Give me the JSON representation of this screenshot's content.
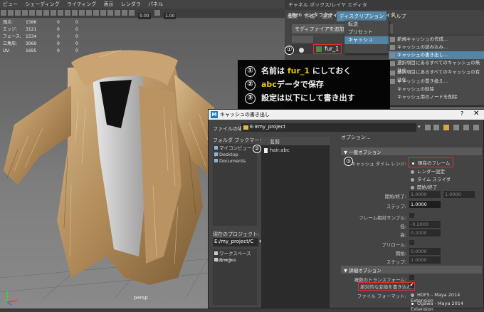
{
  "viewport": {
    "menu": [
      "ビュー",
      "シェーディング",
      "ライティング",
      "表示",
      "レンダラ",
      "パネル"
    ],
    "numbers": [
      "0.00",
      "1.00"
    ],
    "hud": [
      {
        "label": "頂点:",
        "v1": "1586",
        "v2": "0",
        "v3": "0"
      },
      {
        "label": "エッジ:",
        "v1": "3121",
        "v2": "0",
        "v3": "0"
      },
      {
        "label": "フェース:",
        "v1": "1534",
        "v2": "0",
        "v3": "0"
      },
      {
        "label": "三角形:",
        "v1": "3060",
        "v2": "0",
        "v3": "0"
      },
      {
        "label": "UV:",
        "v1": "1695",
        "v2": "0",
        "v3": "0"
      }
    ],
    "camera": "persp"
  },
  "xgen": {
    "tabs": [
      "チャネル ボックス/レイヤ エディタ",
      "XGen インタラクティブ グルーミング エディタ"
    ],
    "menu": [
      "編集",
      "作成",
      "選択",
      "ディスクリプション",
      "ヘルプ"
    ],
    "add_modifier": "モディファイアを追加",
    "add_label": "加",
    "item": "fur_1",
    "dropdown1": [
      "転送",
      "プリセット",
      "キャッシュ"
    ],
    "dropdown2": [
      "新規キャッシュの作成...",
      "キャッシュの読み込み...",
      "キャッシュの書き出し...",
      "選択項目にあるすべてのキャッシュの無効化",
      "選択項目にあるすべてのキャッシュの有効化",
      "キャッシュの置き換え...",
      "キャッシュの削除",
      "キャッシュ用のノードを削除"
    ]
  },
  "annotation": {
    "lines": [
      {
        "num": "①",
        "pre": "名前は ",
        "hl": "fur_1",
        "post": " にしておく"
      },
      {
        "num": "②",
        "pre": "",
        "hl": "abc",
        "post": "データで保存"
      },
      {
        "num": "③",
        "pre": "設定は以下にして書き出す",
        "hl": "",
        "post": ""
      }
    ],
    "c1": "①",
    "c2": "②",
    "c3": "③"
  },
  "dialog": {
    "title": "キャッシュの書き出し",
    "help": "?",
    "close": "✕",
    "location_label": "ファイルの場所:",
    "location": "E:¥my_project",
    "bookmarks_label": "フォルダ ブックマーク:",
    "bookmarks": [
      "マイコンピュータ",
      "Desktop",
      "Documents"
    ],
    "project_label": "現在のプロジェクト:",
    "project": "E:/my_project/C",
    "project_items": [
      "ワークスペースのルート",
      "images"
    ],
    "file_header": "名前",
    "file": "hair.abc",
    "options_label": "オプション...",
    "section1": "一般オプション",
    "time_range_label": "キャッシュ タイム レンジ:",
    "radios": [
      "現在のフレーム",
      "レンダー設定",
      "タイム スライダ",
      "開始/終了"
    ],
    "startend_label": "開始/終了:",
    "start": "1.0000",
    "end": "1.0000",
    "step_label": "ステップ:",
    "step": "1.0000",
    "frame_rel_label": "フレーム相対サンプル:",
    "low_label": "低:",
    "low": "-0.2000",
    "high_label": "高:",
    "high": "0.2000",
    "preroll_label": "プリロール:",
    "pr_start_label": "開始:",
    "pr_start": "0.0000",
    "pr_step_label": "ステップ:",
    "pr_step": "1.0000",
    "section2": "詳細オプション",
    "multi_xform_label": "複数のトランスフォーム:",
    "abs_xform_label": "絶対的な変換を書き込み:",
    "format_label": "ファイル フォーマット:",
    "formats": [
      "HDF5 - Maya 2014 Extension",
      "Ogawa - Maya 2014 Extension"
    ]
  }
}
